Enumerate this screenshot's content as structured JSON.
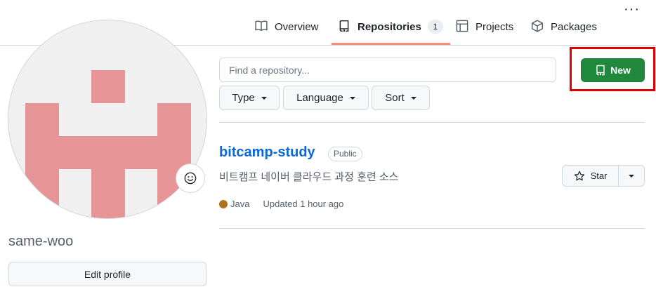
{
  "nav": {
    "tabs": [
      {
        "label": "Overview",
        "icon": "book-icon"
      },
      {
        "label": "Repositories",
        "icon": "repo-icon",
        "count": "1",
        "active": true
      },
      {
        "label": "Projects",
        "icon": "project-table-icon"
      },
      {
        "label": "Packages",
        "icon": "package-icon"
      }
    ],
    "more_icon": "kebab-horizontal-icon"
  },
  "profile": {
    "username": "same-woo",
    "edit_label": "Edit profile",
    "avatar_color": "#e69496",
    "status_icon": "smiley-icon"
  },
  "toolbar": {
    "search_placeholder": "Find a repository...",
    "filters": [
      "Type",
      "Language",
      "Sort"
    ],
    "new_label": "New",
    "new_color": "#1f883d",
    "highlight_color": "#e00000"
  },
  "repos": [
    {
      "name": "bitcamp-study",
      "visibility": "Public",
      "description": "비트캠프 네이버 클라우드 과정 훈련 소스",
      "language": "Java",
      "language_color": "#b07219",
      "updated": "Updated 1 hour ago",
      "star_label": "Star"
    }
  ]
}
